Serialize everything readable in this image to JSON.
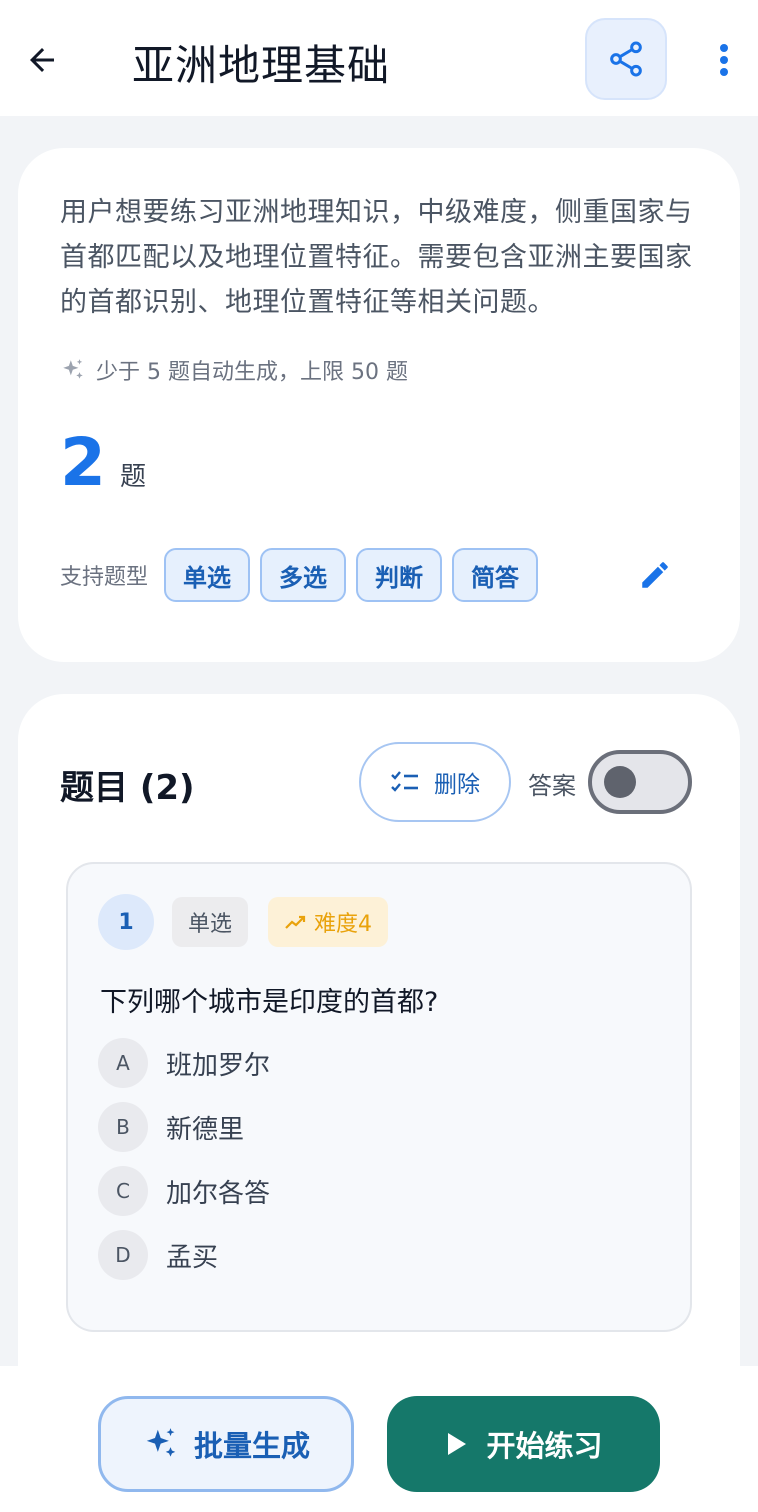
{
  "header": {
    "title": "亚洲地理基础"
  },
  "summary": {
    "description": "用户想要练习亚洲地理知识，中级难度，侧重国家与首都匹配以及地理位置特征。需要包含亚洲主要国家的首都识别、地理位置特征等相关问题。",
    "hint": "少于 5 题自动生成，上限 50 题",
    "count": "2",
    "count_unit": "题",
    "types_label": "支持题型",
    "types": [
      "单选",
      "多选",
      "判断",
      "简答"
    ]
  },
  "questions": {
    "title": "题目 (2)",
    "delete_label": "删除",
    "answer_label": "答案",
    "answer_toggle_on": false,
    "items": [
      {
        "number": "1",
        "type": "单选",
        "difficulty": "难度4",
        "text": "下列哪个城市是印度的首都?",
        "options": [
          {
            "letter": "A",
            "text": "班加罗尔"
          },
          {
            "letter": "B",
            "text": "新德里"
          },
          {
            "letter": "C",
            "text": "加尔各答"
          },
          {
            "letter": "D",
            "text": "孟买"
          }
        ]
      }
    ]
  },
  "bottom": {
    "bulk_label": "批量生成",
    "start_label": "开始练习"
  },
  "colors": {
    "accent": "#1a73e8",
    "primary_button": "#15786a",
    "difficulty": "#e9a20b"
  }
}
